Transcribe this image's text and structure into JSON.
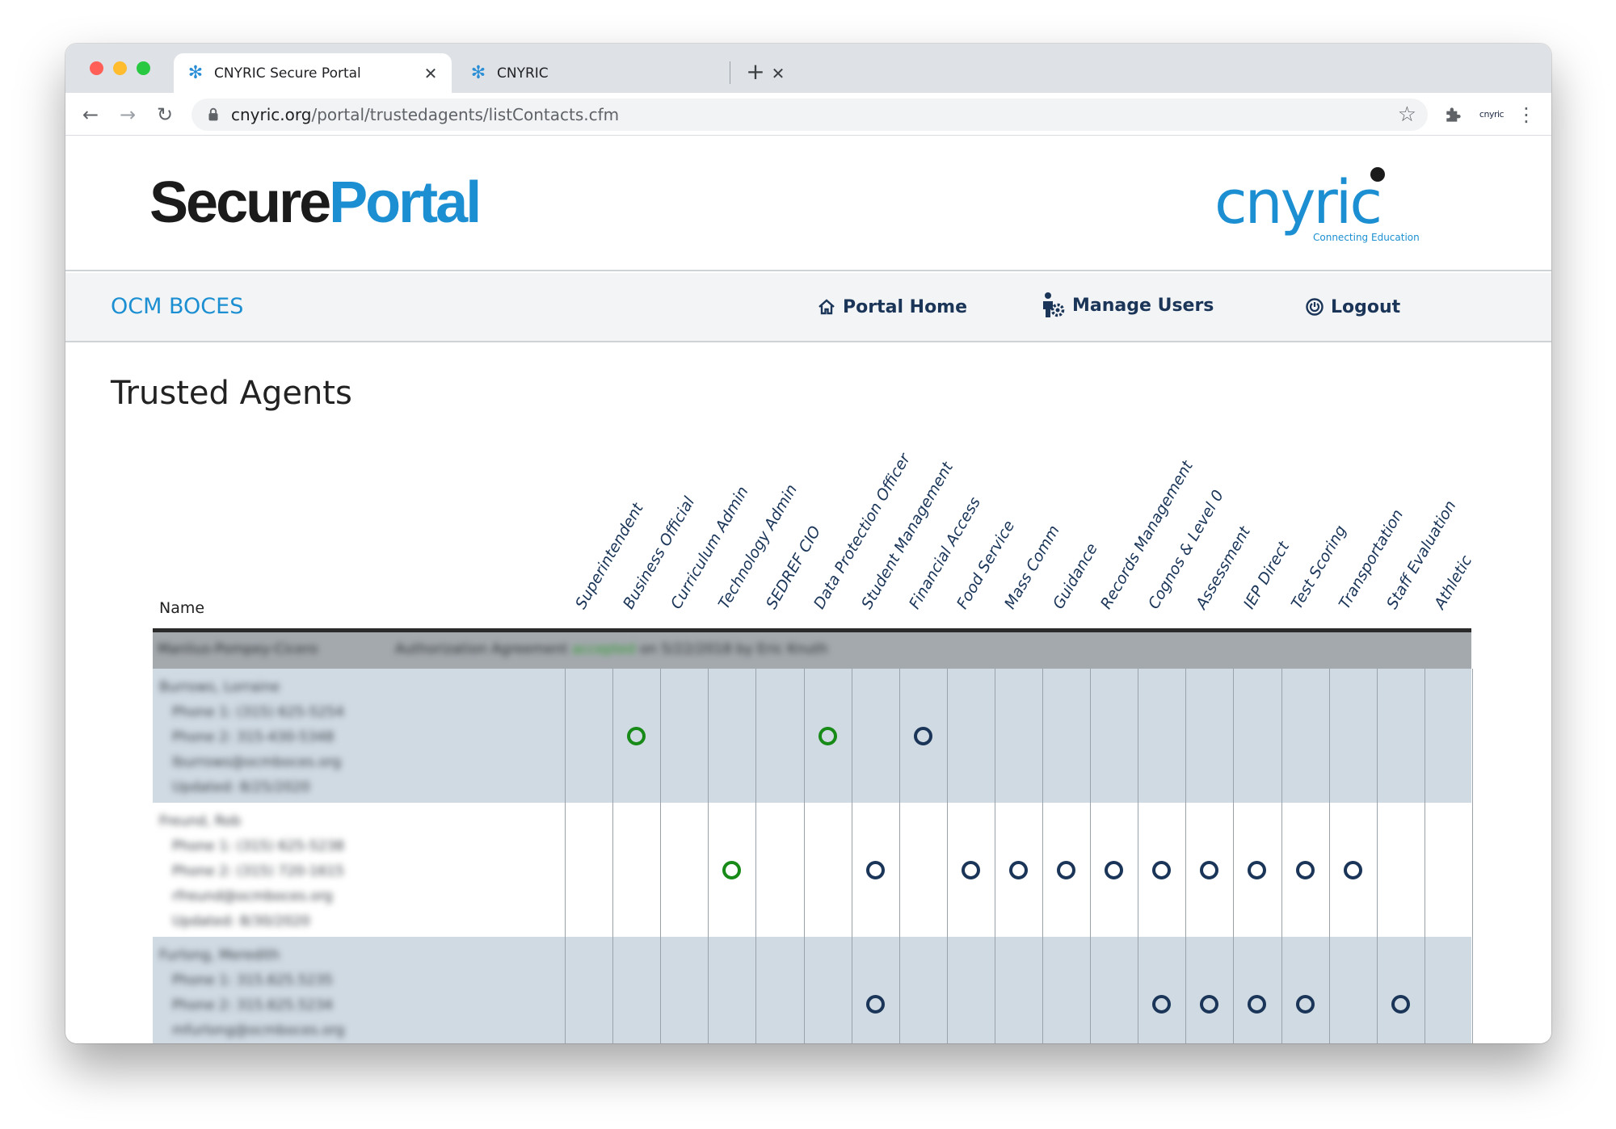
{
  "browser": {
    "tabs": [
      {
        "title": "CNYRIC Secure Portal",
        "close": "✕",
        "active": true
      },
      {
        "title": "CNYRIC",
        "close": "✕",
        "active": false
      }
    ],
    "new_tab": "+",
    "url_host": "cnyric.org",
    "url_path": "/portal/trustedagents/listContacts.cfm",
    "profile": "cnyric"
  },
  "header": {
    "logo_word1": "Secure",
    "logo_word2": "Portal",
    "brand_name": "cnyric",
    "brand_tagline": "Connecting Education"
  },
  "nav": {
    "org": "OCM BOCES",
    "home": "Portal Home",
    "users": "Manage Users",
    "logout": "Logout"
  },
  "page": {
    "title": "Trusted Agents"
  },
  "table": {
    "name_header": "Name",
    "roles": [
      "Superintendent",
      "Business Official",
      "Curriculum Admin",
      "Technology Admin",
      "SEDREF CIO",
      "Data Protection Officer",
      "Student Management",
      "Financial Access",
      "Food Service",
      "Mass Comm",
      "Guidance",
      "Records Management",
      "Cognos & Level 0",
      "Assessment",
      "IEP Direct",
      "Test Scoring",
      "Transportation",
      "Staff Evaluation",
      "Athletic"
    ],
    "group": {
      "district": "Manlius-Pompey-Cicero",
      "agreement_prefix": "Authorization Agreement",
      "agreement_status": "accepted",
      "agreement_suffix": "on 5/22/2018 by Eric Knuth"
    },
    "rows": [
      {
        "name": "Burrows, Lorraine",
        "phone1": "Phone 1: (315) 625-5254",
        "phone2": "Phone 2: 315-430-5348",
        "email": "lburrows@ocmboces.org",
        "updated": "Updated: 8/25/2020",
        "marks": [
          {
            "role": 1,
            "color": "green"
          },
          {
            "role": 5,
            "color": "green"
          },
          {
            "role": 7,
            "color": "navy"
          }
        ]
      },
      {
        "name": "Freund, Rob",
        "phone1": "Phone 1: (315) 625-5238",
        "phone2": "Phone 2: (315) 720-1615",
        "email": "rfreund@ocmboces.org",
        "updated": "Updated: 8/30/2020",
        "marks": [
          {
            "role": 3,
            "color": "green"
          },
          {
            "role": 6,
            "color": "navy"
          },
          {
            "role": 8,
            "color": "navy"
          },
          {
            "role": 9,
            "color": "navy"
          },
          {
            "role": 10,
            "color": "navy"
          },
          {
            "role": 11,
            "color": "navy"
          },
          {
            "role": 12,
            "color": "navy"
          },
          {
            "role": 13,
            "color": "navy"
          },
          {
            "role": 14,
            "color": "navy"
          },
          {
            "role": 15,
            "color": "navy"
          },
          {
            "role": 16,
            "color": "navy"
          }
        ]
      },
      {
        "name": "Furlong, Meredith",
        "phone1": "Phone 1: 315.625.5235",
        "phone2": "Phone 2: 315.625.5234",
        "email": "mfurlong@ocmboces.org",
        "updated": "",
        "marks": [
          {
            "role": 6,
            "color": "navy"
          },
          {
            "role": 12,
            "color": "navy"
          },
          {
            "role": 13,
            "color": "navy"
          },
          {
            "role": 14,
            "color": "navy"
          },
          {
            "role": 15,
            "color": "navy"
          },
          {
            "role": 17,
            "color": "navy"
          }
        ]
      }
    ]
  },
  "colors": {
    "accent_blue": "#1b8fd1",
    "navy": "#1a3558",
    "role_green": "#178a17",
    "row_shade": "#d0dae3",
    "group_gray": "#a4a9ae"
  }
}
